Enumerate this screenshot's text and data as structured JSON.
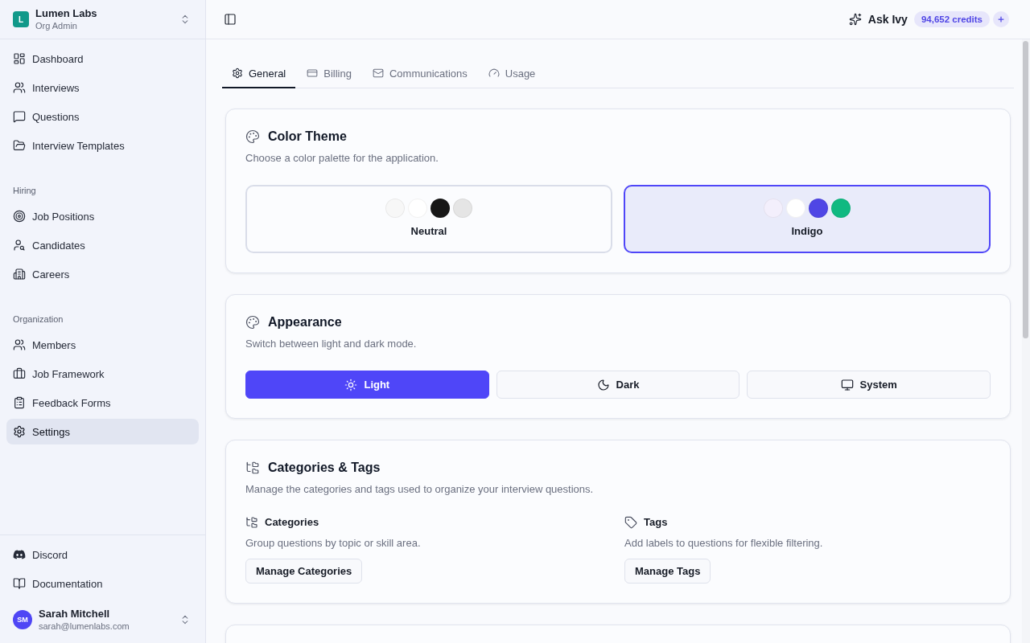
{
  "sidebar": {
    "org": {
      "logo": "L",
      "name": "Lumen Labs",
      "role": "Org Admin"
    },
    "groups": [
      {
        "items": [
          {
            "label": "Dashboard",
            "selected": false
          },
          {
            "label": "Interviews",
            "selected": false
          },
          {
            "label": "Questions",
            "selected": false
          },
          {
            "label": "Interview Templates",
            "selected": false
          }
        ]
      },
      {
        "heading": "Hiring",
        "items": [
          {
            "label": "Job Positions",
            "selected": false
          },
          {
            "label": "Candidates",
            "selected": false
          },
          {
            "label": "Careers",
            "selected": false
          }
        ]
      },
      {
        "heading": "Organization",
        "items": [
          {
            "label": "Members",
            "selected": false
          },
          {
            "label": "Job Framework",
            "selected": false
          },
          {
            "label": "Feedback Forms",
            "selected": false
          },
          {
            "label": "Settings",
            "selected": true
          }
        ]
      }
    ],
    "footer_links": [
      "Discord",
      "Documentation"
    ],
    "user": {
      "initials": "SM",
      "name": "Sarah Mitchell",
      "email": "sarah@lumenlabs.com"
    }
  },
  "topbar": {
    "assistant_label": "Ask Ivy",
    "credits": "94,652 credits"
  },
  "tabs": [
    {
      "label": "General",
      "selected": true
    },
    {
      "label": "Billing",
      "selected": false
    },
    {
      "label": "Communications",
      "selected": false
    },
    {
      "label": "Usage",
      "selected": false
    }
  ],
  "color_theme": {
    "title": "Color Theme",
    "description": "Choose a color palette for the application.",
    "options": [
      {
        "label": "Neutral",
        "selected": false,
        "swatches": [
          {
            "color": "#f7f7f7"
          },
          {
            "color": "#ffffff"
          },
          {
            "color": "#171717"
          },
          {
            "color": "#e5e5e5"
          }
        ]
      },
      {
        "label": "Indigo",
        "selected": true,
        "swatches": [
          {
            "color": "#f3effc"
          },
          {
            "color": "#ffffff"
          },
          {
            "color": "#4f46e5"
          },
          {
            "color": "#10b981"
          }
        ]
      }
    ]
  },
  "appearance": {
    "title": "Appearance",
    "description": "Switch between light and dark mode.",
    "modes": [
      {
        "label": "Light",
        "selected": true
      },
      {
        "label": "Dark",
        "selected": false
      },
      {
        "label": "System",
        "selected": false
      }
    ]
  },
  "categories_tags": {
    "title": "Categories & Tags",
    "description": "Manage the categories and tags used to organize your interview questions.",
    "sections": [
      {
        "title": "Categories",
        "description": "Group questions by topic or skill area.",
        "button": "Manage Categories"
      },
      {
        "title": "Tags",
        "description": "Add labels to questions for flexible filtering.",
        "button": "Manage Tags"
      }
    ]
  }
}
